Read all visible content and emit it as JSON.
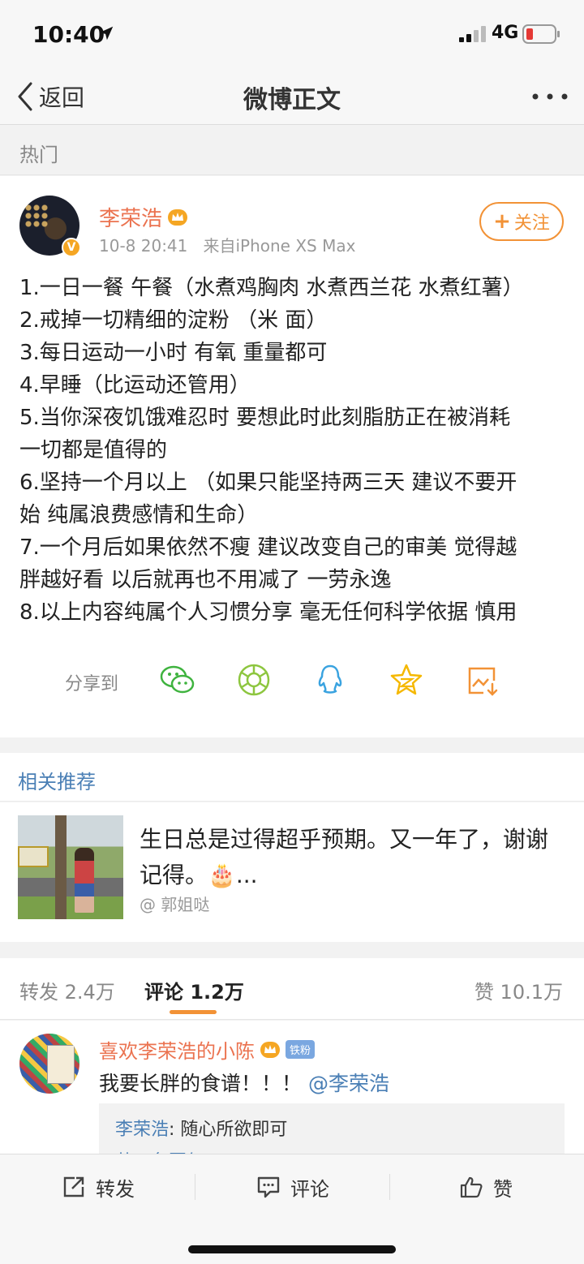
{
  "status_bar": {
    "time": "10:40",
    "network": "4G",
    "battery_color": "#e53935"
  },
  "nav": {
    "back_label": "返回",
    "title": "微博正文"
  },
  "section_hot": "热门",
  "post": {
    "author": "李荣浩",
    "time": "10-8 20:41",
    "source": "来自iPhone XS Max",
    "follow_label": "关注",
    "lines": [
      "1.一日一餐 午餐（水煮鸡胸肉 水煮西兰花 水煮红薯）",
      "2.戒掉一切精细的淀粉 （米 面）",
      "3.每日运动一小时 有氧 重量都可",
      "4.早睡（比运动还管用）",
      "5.当你深夜饥饿难忍时 要想此时此刻脂肪正在被消耗",
      "一切都是值得的",
      "6.坚持一个月以上 （如果只能坚持两三天 建议不要开",
      "始 纯属浪费感情和生命）",
      "7.一个月后如果依然不瘦 建议改变自己的审美 觉得越",
      "胖越好看 以后就再也不用减了 一劳永逸",
      "8.以上内容纯属个人习惯分享 毫无任何科学依据 慎用"
    ],
    "share_label": "分享到",
    "share_icons": [
      "wechat-icon",
      "moments-icon",
      "qq-icon",
      "qzone-icon",
      "save-image-icon"
    ]
  },
  "related": {
    "heading": "相关推荐",
    "title": "生日总是过得超乎预期。又一年了，谢谢记得。🎂...",
    "user": "@ 郭姐哒"
  },
  "tabs": {
    "repost": "转发 2.4万",
    "comment": "评论 1.2万",
    "like": "赞 10.1万"
  },
  "comment": {
    "name": "喜欢李荣浩的小陈",
    "badge": "铁粉",
    "text": "我要长胖的食谱！！！",
    "mention": "@李荣浩",
    "reply_name": "李荣浩",
    "reply_text": ": 随心所欲即可",
    "reply_more": "共…条回复"
  },
  "bottom": {
    "repost": "转发",
    "comment": "评论",
    "like": "赞"
  },
  "colors": {
    "orange": "#f29236",
    "name_orange": "#eb7350",
    "link_blue": "#4a7fb5"
  }
}
